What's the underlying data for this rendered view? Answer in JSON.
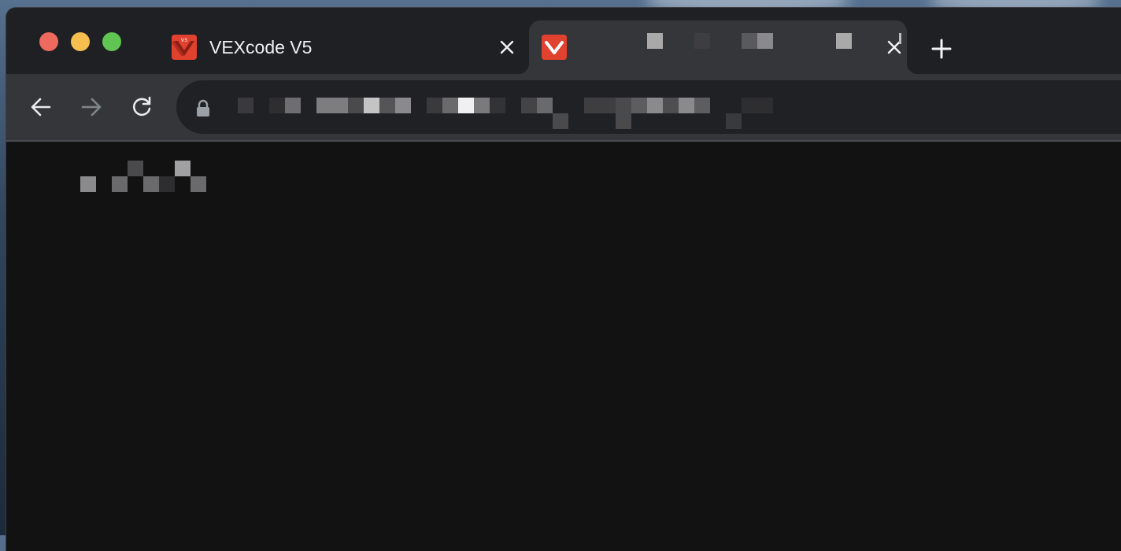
{
  "window_controls": {
    "close": "close-window",
    "minimize": "minimize-window",
    "maximize": "maximize-window"
  },
  "tabs": [
    {
      "title": "VEXcode V5",
      "favicon": "vexcode-favicon",
      "active": false
    },
    {
      "title": "",
      "favicon": "vexcode-favicon",
      "active": true
    }
  ],
  "toolbar": {
    "back": "back-icon",
    "forward": "forward-icon",
    "reload": "reload-icon"
  },
  "address_bar": {
    "secure_icon": "lock-icon",
    "url": ""
  },
  "page": {
    "text": ""
  },
  "colors": {
    "tab_strip": "#1f2024",
    "active_tab": "#35363a",
    "page_background": "#121212",
    "vex_red": "#e1412f"
  }
}
